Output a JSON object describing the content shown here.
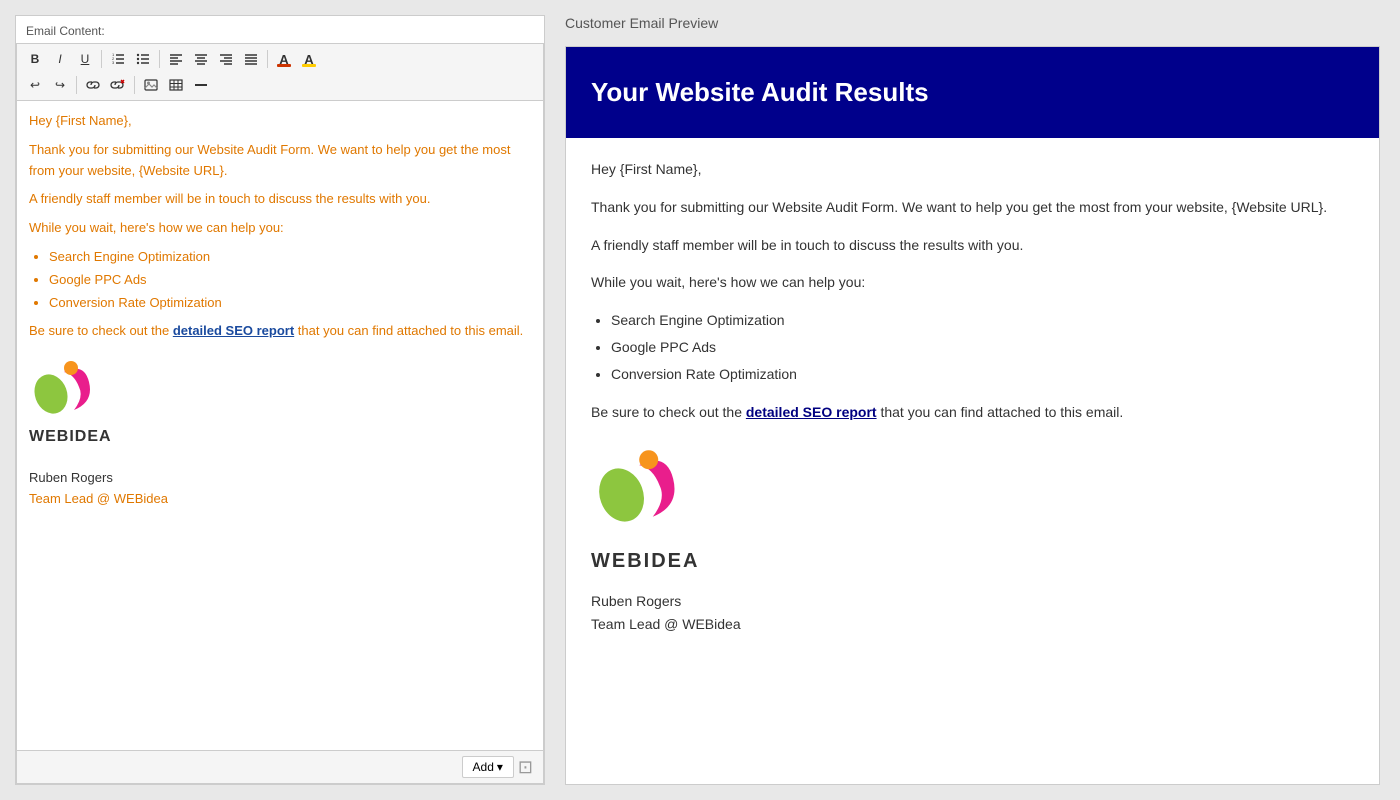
{
  "left_panel": {
    "label": "Email Content:",
    "toolbar": {
      "row1": [
        {
          "icon": "B",
          "name": "bold",
          "title": "Bold"
        },
        {
          "icon": "I",
          "name": "italic",
          "title": "Italic"
        },
        {
          "icon": "U",
          "name": "underline",
          "title": "Underline"
        },
        {
          "icon": "ol",
          "name": "ordered-list",
          "title": "Ordered List"
        },
        {
          "icon": "ul",
          "name": "unordered-list",
          "title": "Unordered List"
        },
        {
          "icon": "al",
          "name": "align-left",
          "title": "Align Left"
        },
        {
          "icon": "ac",
          "name": "align-center",
          "title": "Align Center"
        },
        {
          "icon": "ar",
          "name": "align-right",
          "title": "Align Right"
        },
        {
          "icon": "aj",
          "name": "align-justify",
          "title": "Align Justify"
        },
        {
          "icon": "fc",
          "name": "font-color",
          "title": "Font Color"
        },
        {
          "icon": "bg",
          "name": "bg-color",
          "title": "Background Color"
        }
      ],
      "row2": [
        {
          "icon": "undo",
          "name": "undo",
          "title": "Undo"
        },
        {
          "icon": "redo",
          "name": "redo",
          "title": "Redo"
        },
        {
          "icon": "link",
          "name": "insert-link",
          "title": "Insert Link"
        },
        {
          "icon": "unlink",
          "name": "remove-link",
          "title": "Remove Link"
        },
        {
          "icon": "img",
          "name": "insert-image",
          "title": "Insert Image"
        },
        {
          "icon": "table",
          "name": "insert-table",
          "title": "Insert Table"
        },
        {
          "icon": "hr",
          "name": "horizontal-rule",
          "title": "Horizontal Rule"
        }
      ]
    },
    "content": {
      "greeting": "Hey {First Name},",
      "para1": "Thank you for submitting our Website Audit Form. We want to help you get the most from your website, {Website URL}.",
      "para2": "A friendly staff member will be in touch to discuss the results with you.",
      "para3": "While you wait, here's how we can help you:",
      "list": [
        "Search Engine Optimization",
        "Google PPC Ads",
        "Conversion Rate Optimization"
      ],
      "para4_prefix": "Be sure to check out the ",
      "para4_link": "detailed SEO report",
      "para4_suffix": " that you can find attached to this email.",
      "logo_text_web": "WEB",
      "logo_text_idea": "IDEA",
      "signature_name": "Ruben Rogers",
      "signature_title_prefix": "Team Lead @ ",
      "signature_title_brand": "WEBidea"
    },
    "footer": {
      "add_label": "Add"
    }
  },
  "right_panel": {
    "label": "Customer Email Preview",
    "email": {
      "header_title": "Your Website Audit Results",
      "greeting": "Hey {First Name},",
      "para1": "Thank you for submitting our Website Audit Form. We want to help you get the most from your website, {Website URL}.",
      "para2": "A friendly staff member will be in touch to discuss the results with you.",
      "para3": "While you wait, here's how we can help you:",
      "list": [
        "Search Engine Optimization",
        "Google PPC Ads",
        "Conversion Rate Optimization"
      ],
      "para4_prefix": "Be sure to check out the ",
      "para4_link": "detailed SEO report",
      "para4_suffix": " that you can find attached to this email.",
      "logo_text_web": "WEB",
      "logo_text_idea": "IDEA",
      "signature_name": "Ruben Rogers",
      "signature_title": "Team Lead @ WEBidea"
    }
  }
}
